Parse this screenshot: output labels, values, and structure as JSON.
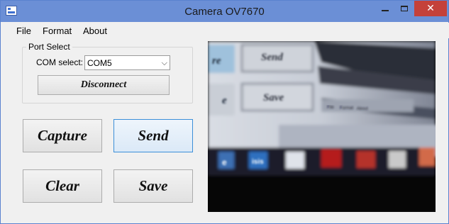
{
  "window": {
    "title": "Camera OV7670",
    "controls": {
      "close_glyph": "✕"
    }
  },
  "menu": [
    "File",
    "Format",
    "About"
  ],
  "port_select": {
    "group_title": "Port Select",
    "com_label": "COM select:",
    "com_value": "COM5",
    "dropdown_arrow": "⌵",
    "disconnect_label": "Disconnect"
  },
  "actions": {
    "capture_label": "Capture",
    "send_label": "Send",
    "clear_label": "Clear",
    "save_label": "Save"
  },
  "preview": {
    "labels": {
      "send": "Send",
      "save": "Save",
      "partial_top": "re",
      "partial_mid": "e",
      "menu_file": "File",
      "menu_format": "Format",
      "menu_about": "About",
      "taskbar_ie": "e",
      "taskbar_isis": "isis"
    }
  },
  "colors": {
    "title_bar": "#6b8fd6",
    "close_button": "#c4413a",
    "focus_border": "#3c8fd8"
  }
}
